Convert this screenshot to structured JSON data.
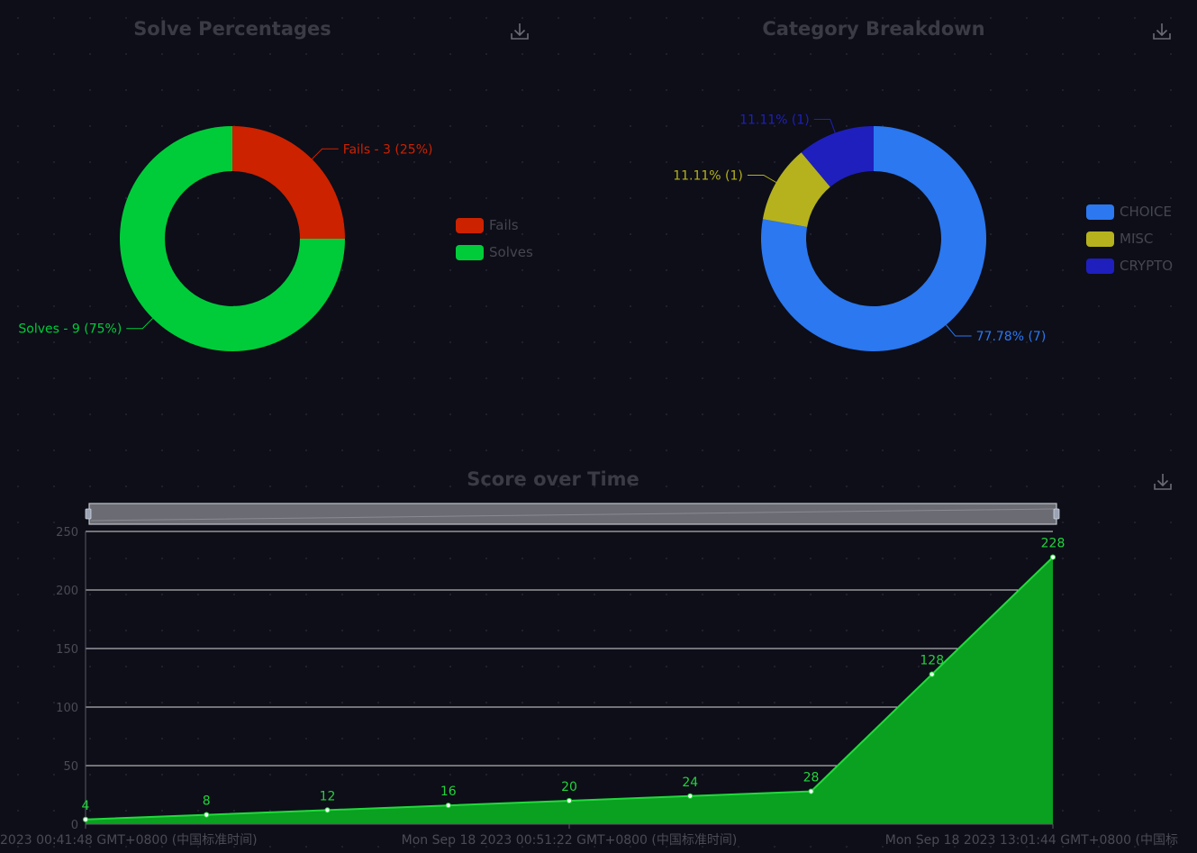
{
  "colors": {
    "fails": "#cc2200",
    "solves": "#00cc3a",
    "choice": "#2b78f0",
    "misc": "#b5b21e",
    "crypto": "#1f1fbe",
    "area_fill": "#0aa020",
    "area_line": "#23d83c",
    "grid": "#d9d9d9"
  },
  "charts": {
    "solve": {
      "title": "Solve Percentages",
      "download_icon": "download-icon",
      "labels": [
        "Fails - 3 (25%)",
        "Solves - 9 (75%)"
      ],
      "legend": [
        "Fails",
        "Solves"
      ]
    },
    "category": {
      "title": "Category Breakdown",
      "download_icon": "download-icon",
      "labels": [
        "77.78% (7)",
        "11.11% (1)",
        "11.11% (1)"
      ],
      "legend": [
        "CHOICE",
        "MISC",
        "CRYPTO"
      ]
    },
    "score": {
      "title": "Score over Time",
      "download_icon": "download-icon",
      "time_labels": [
        "2023 00:41:48 GMT+0800 (中国标准时间)",
        "Mon Sep 18 2023 00:51:22 GMT+0800 (中国标准时间)",
        "Mon Sep 18 2023 13:01:44 GMT+0800 (中国标"
      ]
    }
  },
  "chart_data": [
    {
      "type": "pie",
      "title": "Solve Percentages",
      "categories": [
        "Fails",
        "Solves"
      ],
      "values": [
        3,
        9
      ],
      "legend_position": "right"
    },
    {
      "type": "pie",
      "title": "Category Breakdown",
      "categories": [
        "CHOICE",
        "MISC",
        "CRYPTO"
      ],
      "values": [
        7,
        1,
        1
      ],
      "legend_position": "right"
    },
    {
      "type": "area",
      "title": "Score over Time",
      "x": [
        "2023 00:41:48 GMT+0800 (中国标准时间)",
        "",
        "",
        "",
        "Mon Sep 18 2023 00:51:22 GMT+0800 (中国标准时间)",
        "",
        "",
        "",
        "Mon Sep 18 2023 13:01:44 GMT+0800 (中国标"
      ],
      "values": [
        4,
        8,
        12,
        16,
        20,
        24,
        28,
        128,
        228
      ],
      "ylim": [
        0,
        250
      ],
      "yticks": [
        0,
        50,
        100,
        150,
        200,
        250
      ],
      "grid": true
    }
  ]
}
